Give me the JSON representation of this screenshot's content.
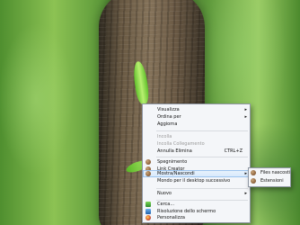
{
  "context_menu": {
    "items": [
      {
        "label": "Visualizza",
        "submenu": true
      },
      {
        "label": "Ordina per",
        "submenu": true
      },
      {
        "label": "Aggiorna"
      },
      {
        "label": "Incolla",
        "disabled": true
      },
      {
        "label": "Incolla Collegamento",
        "disabled": true
      },
      {
        "label": "Annulla Elimina",
        "shortcut": "CTRL+Z"
      },
      {
        "label": "Spegnimento",
        "icon": "power-sphere-icon"
      },
      {
        "label": "Link Creator",
        "icon": "link-sphere-icon"
      },
      {
        "label": "Mostra/Nascondi",
        "icon": "toggle-sphere-icon",
        "submenu": true
      },
      {
        "label": "Mondo per il desktop successivo"
      },
      {
        "label": "Nuovo",
        "submenu": true
      },
      {
        "label": "Cerca...",
        "icon": "search-green-icon"
      },
      {
        "label": "Risoluzione dello schermo",
        "icon": "monitor-icon"
      },
      {
        "label": "Personalizza",
        "icon": "palette-icon"
      }
    ],
    "arrow_glyph": "▸"
  },
  "submenu": {
    "items": [
      {
        "label": "Files nascosti",
        "icon": "hidden-files-icon"
      },
      {
        "label": "Estensioni",
        "icon": "extensions-icon"
      }
    ]
  },
  "colors": {
    "menu_bg": "#f4f6f9",
    "highlight": "#d6e8fb",
    "disabled_text": "#9a9a9a"
  }
}
